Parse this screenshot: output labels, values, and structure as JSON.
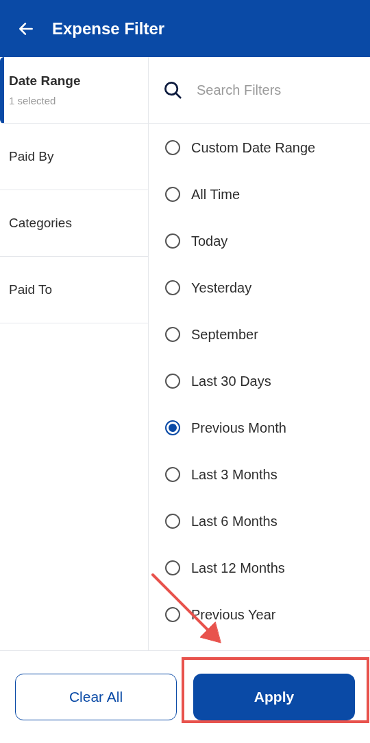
{
  "header": {
    "title": "Expense Filter"
  },
  "categories": [
    {
      "label": "Date Range",
      "subtitle": "1 selected",
      "selected": true
    },
    {
      "label": "Paid By",
      "selected": false
    },
    {
      "label": "Categories",
      "selected": false
    },
    {
      "label": "Paid To",
      "selected": false
    }
  ],
  "search": {
    "placeholder": "Search Filters"
  },
  "options": [
    {
      "label": "Custom Date Range",
      "selected": false
    },
    {
      "label": "All Time",
      "selected": false
    },
    {
      "label": "Today",
      "selected": false
    },
    {
      "label": "Yesterday",
      "selected": false
    },
    {
      "label": "September",
      "selected": false
    },
    {
      "label": "Last 30 Days",
      "selected": false
    },
    {
      "label": "Previous Month",
      "selected": true
    },
    {
      "label": "Last 3 Months",
      "selected": false
    },
    {
      "label": "Last 6 Months",
      "selected": false
    },
    {
      "label": "Last 12 Months",
      "selected": false
    },
    {
      "label": "Previous Year",
      "selected": false
    }
  ],
  "buttons": {
    "clear": "Clear All",
    "apply": "Apply"
  }
}
